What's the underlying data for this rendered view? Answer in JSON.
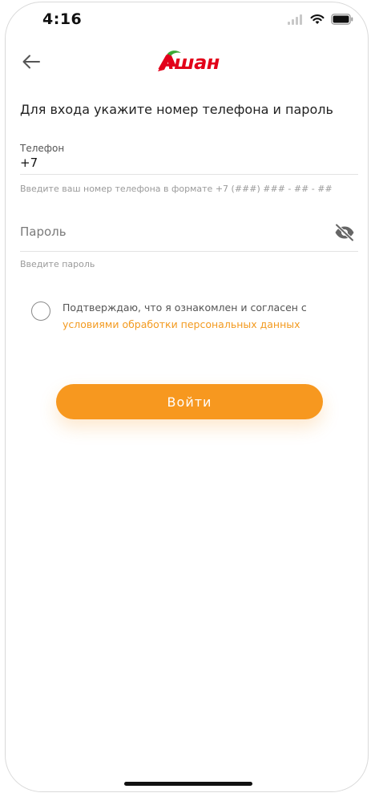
{
  "status_bar": {
    "time": "4:16",
    "signal_icon": "signal-bars-icon",
    "wifi_icon": "wifi-icon",
    "battery_icon": "battery-icon"
  },
  "header": {
    "back_icon": "arrow-left-icon",
    "logo_text": "Ашан"
  },
  "form": {
    "heading": "Для входа укажите номер телефона и пароль",
    "phone": {
      "label": "Телефон",
      "value": "+7",
      "hint": "Введите ваш номер телефона в формате +7 (###) ### - ## - ##"
    },
    "password": {
      "placeholder": "Пароль",
      "hint": "Введите пароль",
      "toggle_icon": "eye-off-icon"
    },
    "consent": {
      "text": "Подтверждаю, что я ознакомлен и согласен с",
      "link": "условиями обработки персональных данных",
      "checked": false
    },
    "submit_label": "Войти"
  },
  "colors": {
    "accent": "#f7981f",
    "link": "#f39a1f",
    "brand_red": "#e2001a"
  }
}
